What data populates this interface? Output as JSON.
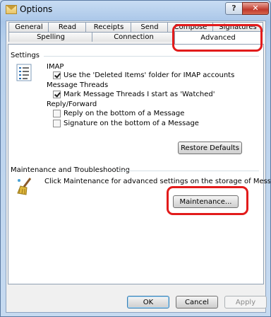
{
  "window": {
    "title": "Options"
  },
  "title_buttons": {
    "help": "?",
    "close": "✕"
  },
  "tabs": {
    "row_back": [
      "General",
      "Read",
      "Receipts",
      "Send",
      "Compose",
      "Signatures"
    ],
    "row_front": [
      "Spelling",
      "Connection",
      "Advanced"
    ],
    "active": "Advanced"
  },
  "settings": {
    "group_label": "Settings",
    "imap_label": "IMAP",
    "imap_deleted_items": {
      "label": "Use the 'Deleted Items' folder for IMAP accounts",
      "checked": true
    },
    "threads_label": "Message Threads",
    "mark_threads_watched": {
      "label": "Mark Message Threads I start as 'Watched'",
      "checked": true
    },
    "reply_label": "Reply/Forward",
    "reply_bottom": {
      "label": "Reply on the bottom of a Message",
      "checked": false
    },
    "signature_bottom": {
      "label": "Signature on the bottom of a Message",
      "checked": false
    },
    "restore_defaults": "Restore Defaults"
  },
  "maintenance": {
    "group_label": "Maintenance and Troubleshooting",
    "description": "Click Maintenance for advanced settings on the storage of Messages.",
    "button": "Maintenance..."
  },
  "footer": {
    "ok": "OK",
    "cancel": "Cancel",
    "apply": "Apply"
  },
  "colors": {
    "highlight": "#e21b1b",
    "title_bar": "#b8d1ec",
    "close_button": "#c0392b"
  },
  "icons": [
    "app-envelope-icon",
    "settings-list-icon",
    "broom-icon",
    "help-icon",
    "close-icon"
  ]
}
